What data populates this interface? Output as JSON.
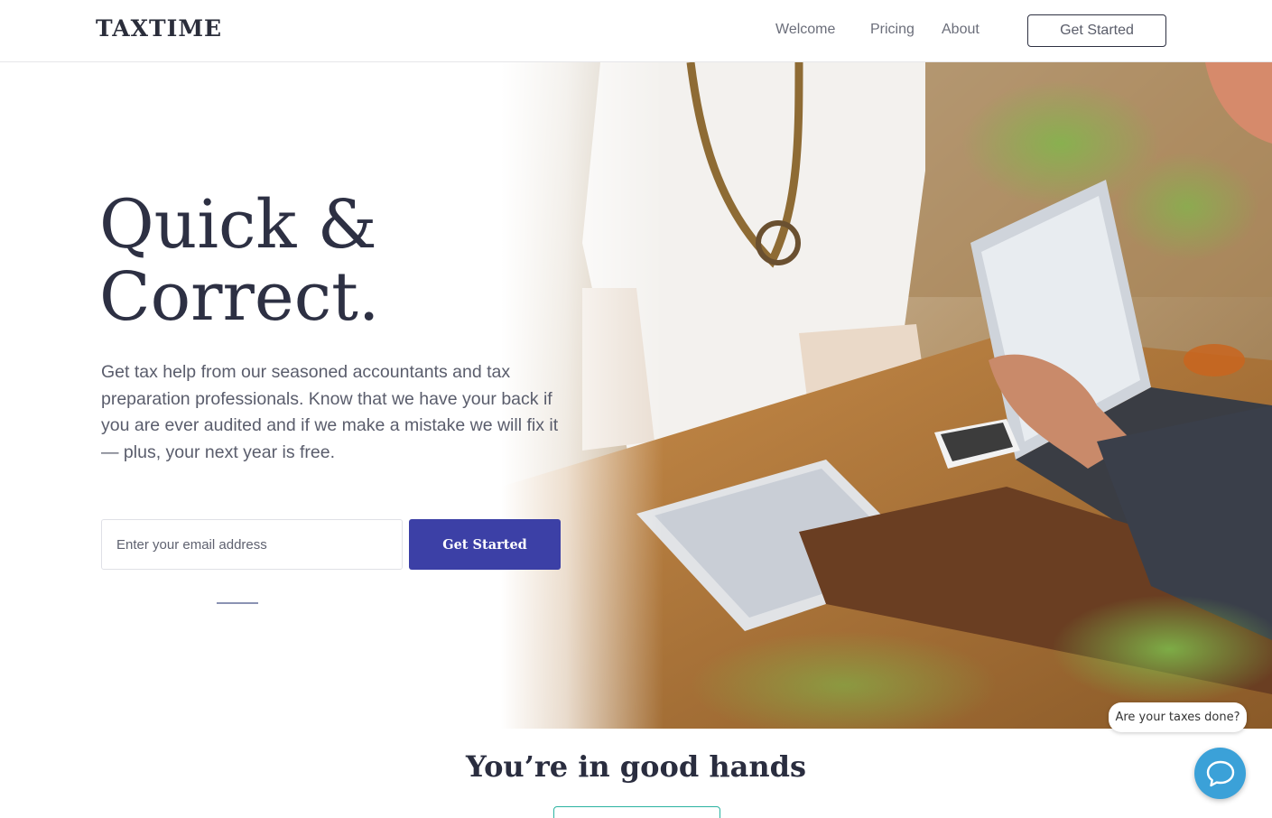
{
  "header": {
    "logo": "TAXTIME",
    "nav": [
      {
        "label": "Welcome"
      },
      {
        "label": "Pricing"
      },
      {
        "label": "About"
      }
    ],
    "cta_label": "Get Started"
  },
  "hero": {
    "title_line1": "Quick &",
    "title_line2": "Correct.",
    "description": "Get tax help from our seasoned accountants and tax preparation professionals. Know that we have your back if you are ever audited and if we make a mistake we will fix it — plus, your next year is free.",
    "email_placeholder": "Enter your email address",
    "cta_label": "Get Started"
  },
  "section": {
    "title": "You’re in good hands"
  },
  "chat": {
    "bubble_text": "Are your taxes done?",
    "icon": "chat-icon"
  },
  "colors": {
    "primary": "#3c40a6",
    "text_dark": "#2d3043",
    "chat": "#3ba1d8",
    "accent_teal": "#2bb3a1"
  }
}
